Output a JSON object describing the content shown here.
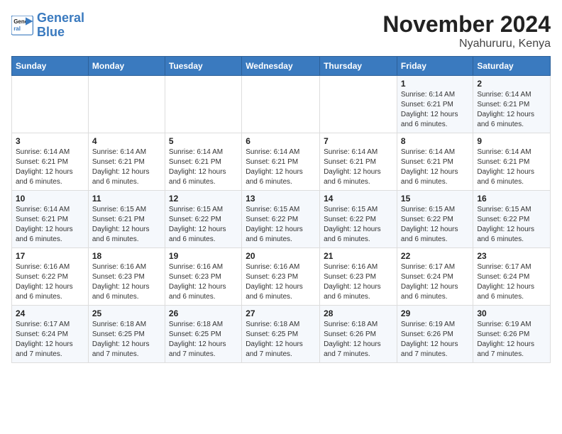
{
  "logo": {
    "line1": "General",
    "line2": "Blue"
  },
  "title": "November 2024",
  "subtitle": "Nyahururu, Kenya",
  "weekdays": [
    "Sunday",
    "Monday",
    "Tuesday",
    "Wednesday",
    "Thursday",
    "Friday",
    "Saturday"
  ],
  "weeks": [
    [
      {
        "day": "",
        "detail": ""
      },
      {
        "day": "",
        "detail": ""
      },
      {
        "day": "",
        "detail": ""
      },
      {
        "day": "",
        "detail": ""
      },
      {
        "day": "",
        "detail": ""
      },
      {
        "day": "1",
        "detail": "Sunrise: 6:14 AM\nSunset: 6:21 PM\nDaylight: 12 hours and 6 minutes."
      },
      {
        "day": "2",
        "detail": "Sunrise: 6:14 AM\nSunset: 6:21 PM\nDaylight: 12 hours and 6 minutes."
      }
    ],
    [
      {
        "day": "3",
        "detail": "Sunrise: 6:14 AM\nSunset: 6:21 PM\nDaylight: 12 hours and 6 minutes."
      },
      {
        "day": "4",
        "detail": "Sunrise: 6:14 AM\nSunset: 6:21 PM\nDaylight: 12 hours and 6 minutes."
      },
      {
        "day": "5",
        "detail": "Sunrise: 6:14 AM\nSunset: 6:21 PM\nDaylight: 12 hours and 6 minutes."
      },
      {
        "day": "6",
        "detail": "Sunrise: 6:14 AM\nSunset: 6:21 PM\nDaylight: 12 hours and 6 minutes."
      },
      {
        "day": "7",
        "detail": "Sunrise: 6:14 AM\nSunset: 6:21 PM\nDaylight: 12 hours and 6 minutes."
      },
      {
        "day": "8",
        "detail": "Sunrise: 6:14 AM\nSunset: 6:21 PM\nDaylight: 12 hours and 6 minutes."
      },
      {
        "day": "9",
        "detail": "Sunrise: 6:14 AM\nSunset: 6:21 PM\nDaylight: 12 hours and 6 minutes."
      }
    ],
    [
      {
        "day": "10",
        "detail": "Sunrise: 6:14 AM\nSunset: 6:21 PM\nDaylight: 12 hours and 6 minutes."
      },
      {
        "day": "11",
        "detail": "Sunrise: 6:15 AM\nSunset: 6:21 PM\nDaylight: 12 hours and 6 minutes."
      },
      {
        "day": "12",
        "detail": "Sunrise: 6:15 AM\nSunset: 6:22 PM\nDaylight: 12 hours and 6 minutes."
      },
      {
        "day": "13",
        "detail": "Sunrise: 6:15 AM\nSunset: 6:22 PM\nDaylight: 12 hours and 6 minutes."
      },
      {
        "day": "14",
        "detail": "Sunrise: 6:15 AM\nSunset: 6:22 PM\nDaylight: 12 hours and 6 minutes."
      },
      {
        "day": "15",
        "detail": "Sunrise: 6:15 AM\nSunset: 6:22 PM\nDaylight: 12 hours and 6 minutes."
      },
      {
        "day": "16",
        "detail": "Sunrise: 6:15 AM\nSunset: 6:22 PM\nDaylight: 12 hours and 6 minutes."
      }
    ],
    [
      {
        "day": "17",
        "detail": "Sunrise: 6:16 AM\nSunset: 6:22 PM\nDaylight: 12 hours and 6 minutes."
      },
      {
        "day": "18",
        "detail": "Sunrise: 6:16 AM\nSunset: 6:23 PM\nDaylight: 12 hours and 6 minutes."
      },
      {
        "day": "19",
        "detail": "Sunrise: 6:16 AM\nSunset: 6:23 PM\nDaylight: 12 hours and 6 minutes."
      },
      {
        "day": "20",
        "detail": "Sunrise: 6:16 AM\nSunset: 6:23 PM\nDaylight: 12 hours and 6 minutes."
      },
      {
        "day": "21",
        "detail": "Sunrise: 6:16 AM\nSunset: 6:23 PM\nDaylight: 12 hours and 6 minutes."
      },
      {
        "day": "22",
        "detail": "Sunrise: 6:17 AM\nSunset: 6:24 PM\nDaylight: 12 hours and 6 minutes."
      },
      {
        "day": "23",
        "detail": "Sunrise: 6:17 AM\nSunset: 6:24 PM\nDaylight: 12 hours and 6 minutes."
      }
    ],
    [
      {
        "day": "24",
        "detail": "Sunrise: 6:17 AM\nSunset: 6:24 PM\nDaylight: 12 hours and 7 minutes."
      },
      {
        "day": "25",
        "detail": "Sunrise: 6:18 AM\nSunset: 6:25 PM\nDaylight: 12 hours and 7 minutes."
      },
      {
        "day": "26",
        "detail": "Sunrise: 6:18 AM\nSunset: 6:25 PM\nDaylight: 12 hours and 7 minutes."
      },
      {
        "day": "27",
        "detail": "Sunrise: 6:18 AM\nSunset: 6:25 PM\nDaylight: 12 hours and 7 minutes."
      },
      {
        "day": "28",
        "detail": "Sunrise: 6:18 AM\nSunset: 6:26 PM\nDaylight: 12 hours and 7 minutes."
      },
      {
        "day": "29",
        "detail": "Sunrise: 6:19 AM\nSunset: 6:26 PM\nDaylight: 12 hours and 7 minutes."
      },
      {
        "day": "30",
        "detail": "Sunrise: 6:19 AM\nSunset: 6:26 PM\nDaylight: 12 hours and 7 minutes."
      }
    ]
  ]
}
